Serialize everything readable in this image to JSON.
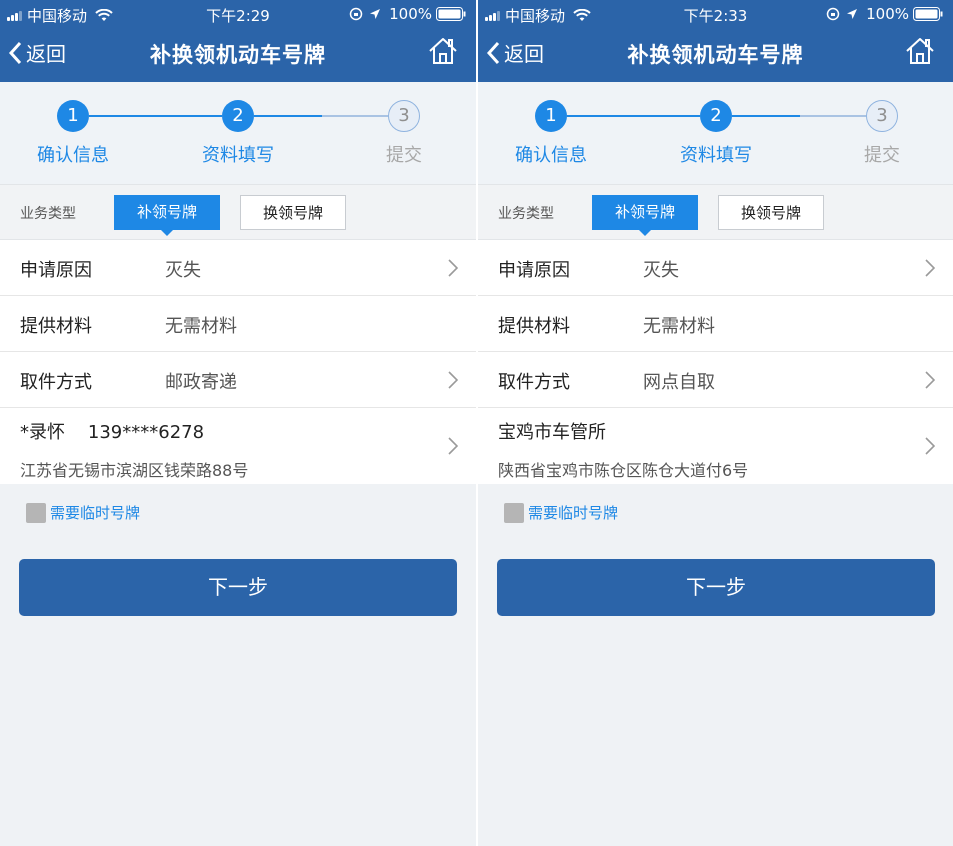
{
  "colors": {
    "accent": "#1e88e5",
    "navbar": "#2b64a9",
    "background": "#eff2f5"
  },
  "screens": [
    {
      "status": {
        "carrier": "中国移动",
        "time": "下午2:29",
        "battery": "100%"
      },
      "nav": {
        "back_label": "返回",
        "title": "补换领机动车号牌",
        "home_icon": "home-icon"
      },
      "steps": [
        {
          "number": "1",
          "label": "确认信息",
          "state": "done"
        },
        {
          "number": "2",
          "label": "资料填写",
          "state": "current"
        },
        {
          "number": "3",
          "label": "提交",
          "state": "pending"
        }
      ],
      "business_type": {
        "label": "业务类型",
        "options": [
          "补领号牌",
          "换领号牌"
        ],
        "selected": "补领号牌"
      },
      "fields": [
        {
          "label": "申请原因",
          "value": "灭失",
          "has_chevron": true
        },
        {
          "label": "提供材料",
          "value": "无需材料",
          "has_chevron": false
        },
        {
          "label": "取件方式",
          "value": "邮政寄递",
          "has_chevron": true
        }
      ],
      "address": {
        "name": "*录怀    139****6278",
        "line": "江苏省无锡市滨湖区钱荣路88号"
      },
      "temp_plate_label": "需要临时号牌",
      "next_label": "下一步"
    },
    {
      "status": {
        "carrier": "中国移动",
        "time": "下午2:33",
        "battery": "100%"
      },
      "nav": {
        "back_label": "返回",
        "title": "补换领机动车号牌",
        "home_icon": "home-icon"
      },
      "steps": [
        {
          "number": "1",
          "label": "确认信息",
          "state": "done"
        },
        {
          "number": "2",
          "label": "资料填写",
          "state": "current"
        },
        {
          "number": "3",
          "label": "提交",
          "state": "pending"
        }
      ],
      "business_type": {
        "label": "业务类型",
        "options": [
          "补领号牌",
          "换领号牌"
        ],
        "selected": "补领号牌"
      },
      "fields": [
        {
          "label": "申请原因",
          "value": "灭失",
          "has_chevron": true
        },
        {
          "label": "提供材料",
          "value": "无需材料",
          "has_chevron": false
        },
        {
          "label": "取件方式",
          "value": "网点自取",
          "has_chevron": true
        }
      ],
      "address": {
        "name": "宝鸡市车管所",
        "line": "陕西省宝鸡市陈仓区陈仓大道付6号"
      },
      "temp_plate_label": "需要临时号牌",
      "next_label": "下一步"
    }
  ]
}
